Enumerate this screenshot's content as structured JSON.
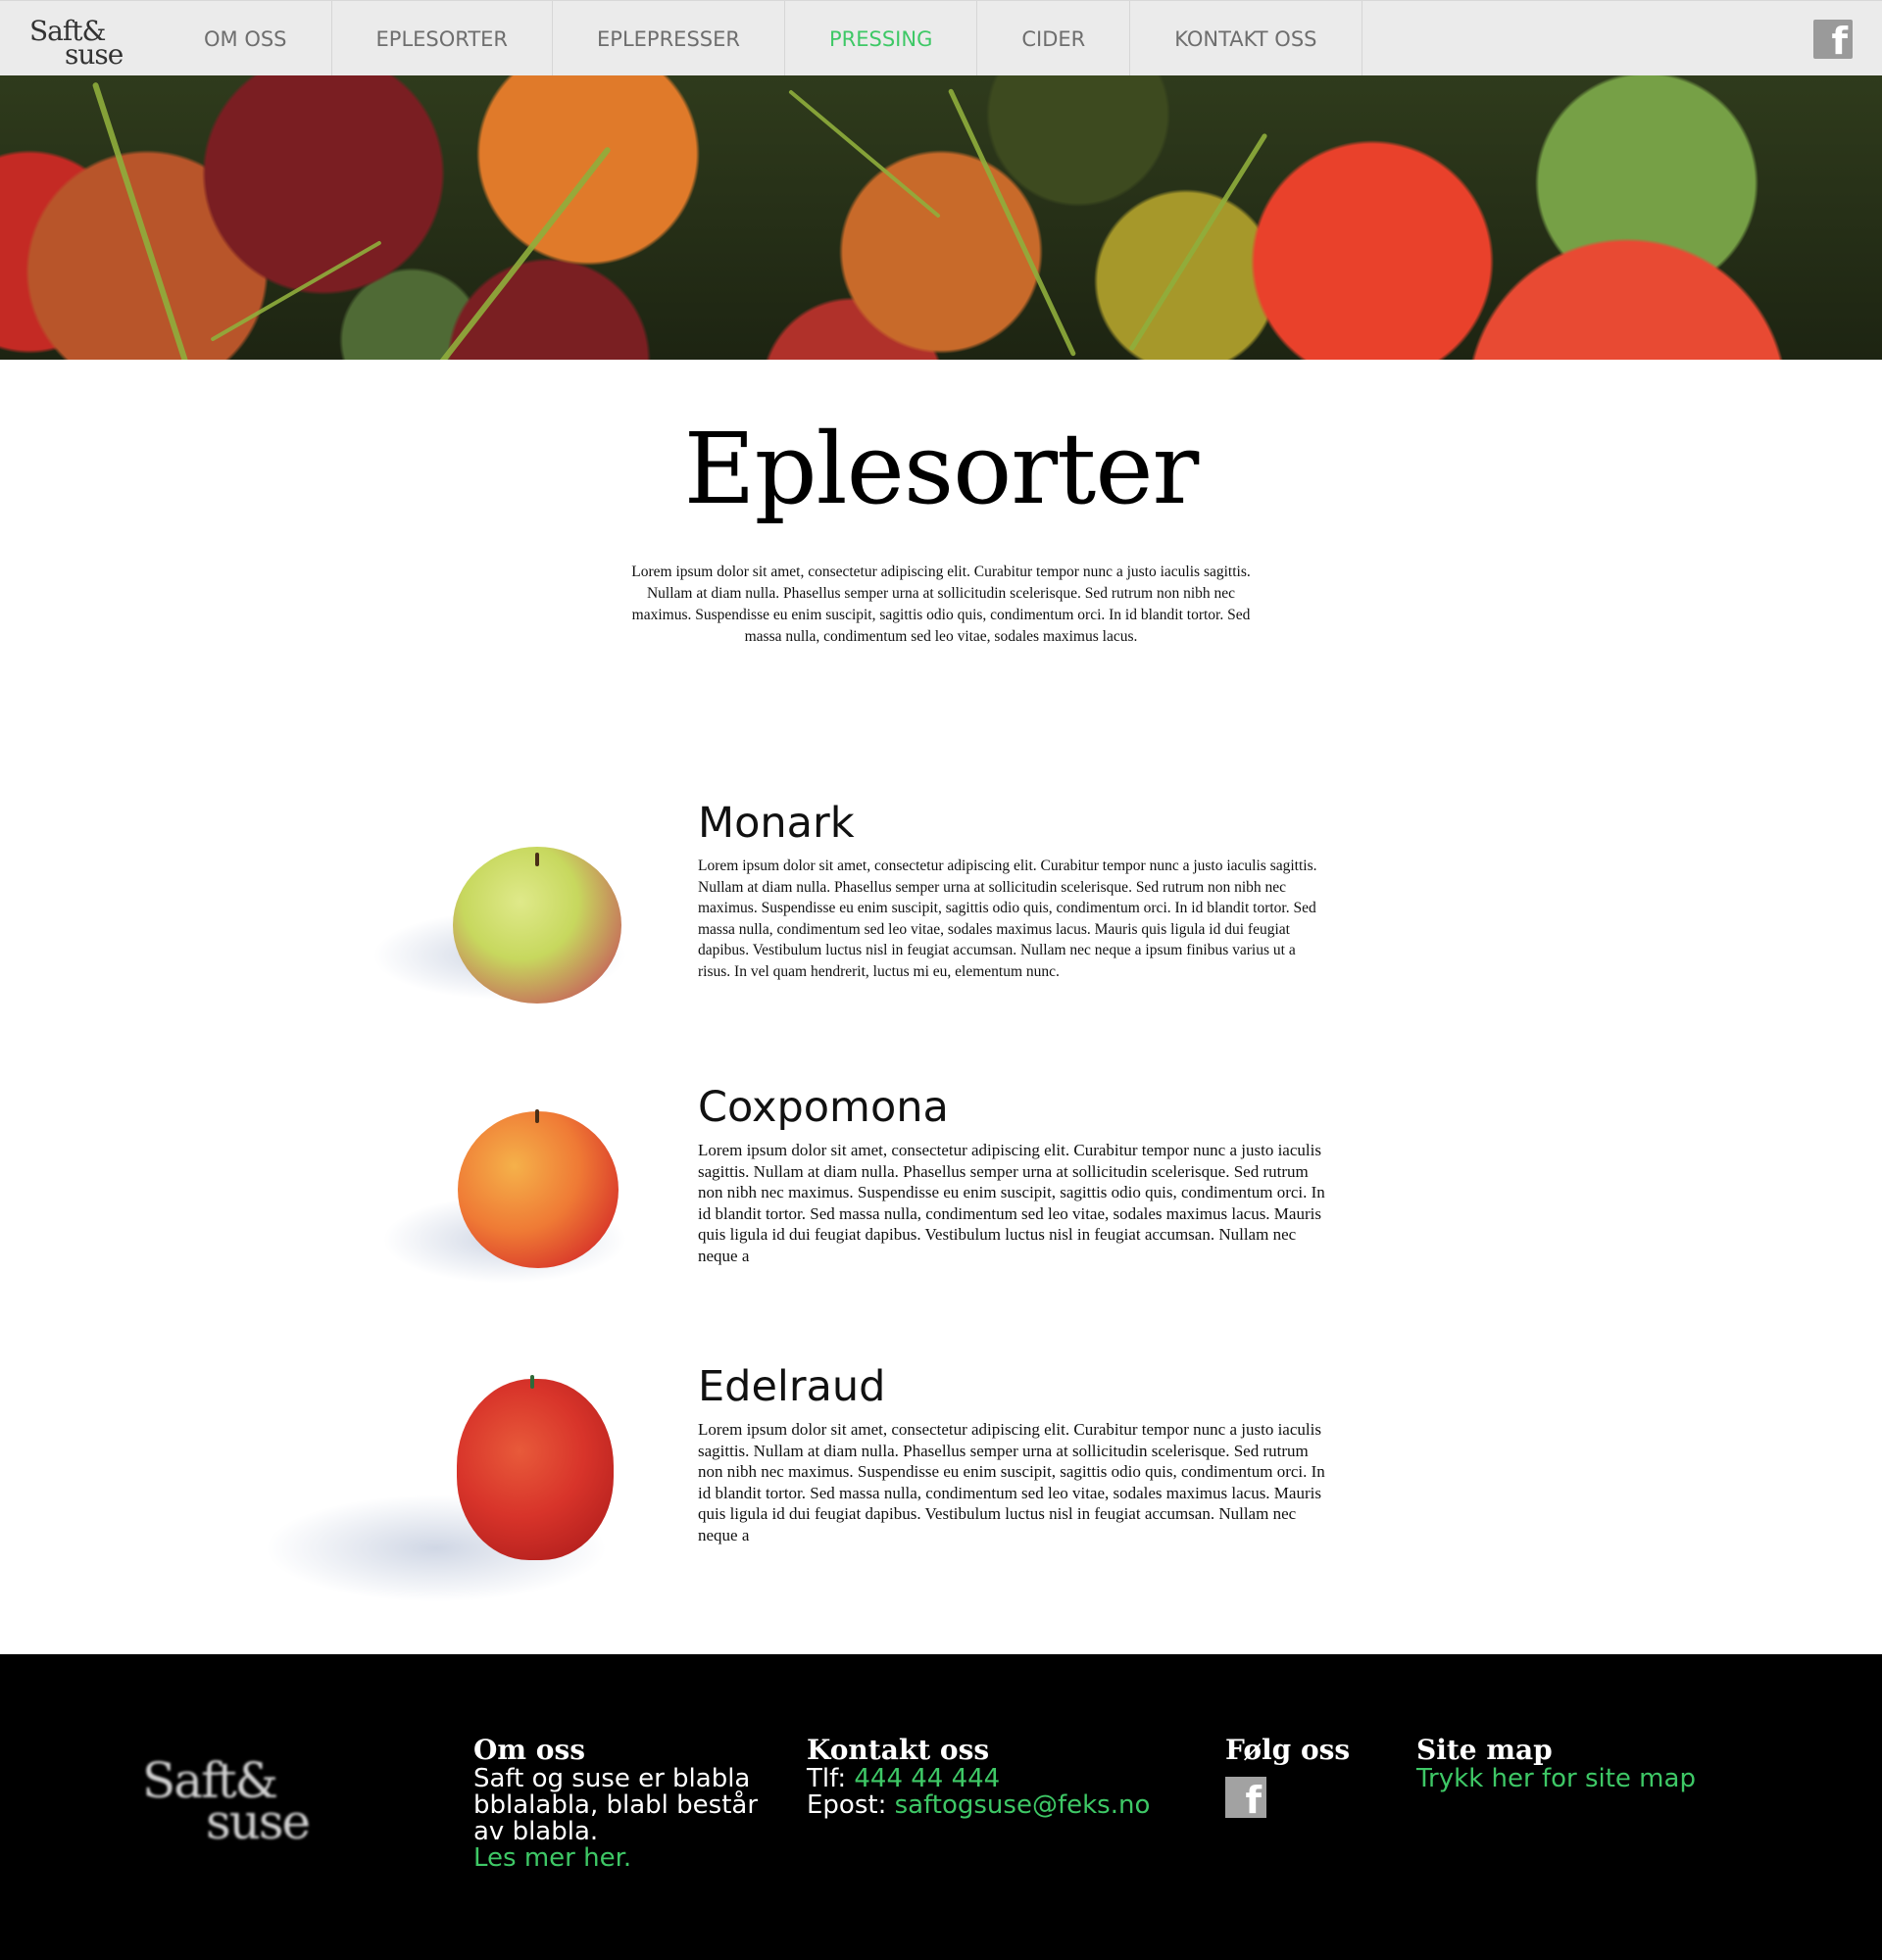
{
  "nav": {
    "logo_line1": "Saft&",
    "logo_line2": "suse",
    "items": [
      {
        "label": "OM OSS"
      },
      {
        "label": "EPLESORTER"
      },
      {
        "label": "EPLEPRESSER"
      },
      {
        "label": "PRESSING"
      },
      {
        "label": "CIDER"
      },
      {
        "label": "KONTAKT OSS"
      }
    ],
    "active_item": "PRESSING",
    "facebook_icon": "facebook-icon"
  },
  "colors": {
    "accent_green": "#3ec866",
    "nav_background": "#ebebeb",
    "footer_background": "#000000"
  },
  "main": {
    "title": "Eplesorter",
    "intro": "Lorem ipsum dolor sit amet, consectetur adipiscing elit. Curabitur tempor nunc a justo iaculis sagittis. Nullam at diam nulla. Phasellus semper urna at sollicitudin scelerisque. Sed rutrum non nibh nec maximus. Suspendisse eu enim suscipit, sagittis odio quis, condimentum orci. In id blandit tortor. Sed massa nulla, condimentum sed leo vitae, sodales maximus lacus."
  },
  "varieties": [
    {
      "name": "Monark",
      "text": "Lorem ipsum dolor sit amet, consectetur adipiscing elit. Curabitur tempor nunc a justo iaculis sagittis. Nullam at diam nulla. Phasellus semper urna at sollicitudin scelerisque. Sed rutrum non nibh nec maximus. Suspendisse eu enim suscipit, sagittis odio quis, condimentum orci. In id blandit tortor. Sed massa nulla, condimentum sed leo vitae, sodales maximus lacus. Mauris quis ligula id dui feugiat dapibus. Vestibulum luctus nisl in feugiat accumsan. Nullam nec neque a ipsum finibus varius ut a risus. In vel quam hendrerit, luctus mi eu, elementum nunc."
    },
    {
      "name": "Coxpomona",
      "text": "Lorem ipsum dolor sit amet, consectetur adipiscing elit. Curabitur tempor nunc a justo iaculis sagittis. Nullam at diam nulla. Phasellus semper urna at sollicitudin scelerisque. Sed rutrum non nibh nec maximus. Suspendisse eu enim suscipit, sagittis odio quis, condimentum orci. In id blandit tortor. Sed massa nulla, condimentum sed leo vitae, sodales maximus lacus. Mauris quis ligula id dui feugiat dapibus. Vestibulum luctus nisl in feugiat accumsan. Nullam nec neque a"
    },
    {
      "name": "Edelraud",
      "text": "Lorem ipsum dolor sit amet, consectetur adipiscing elit. Curabitur tempor nunc a justo iaculis sagittis. Nullam at diam nulla. Phasellus semper urna at sollicitudin scelerisque. Sed rutrum non nibh nec maximus. Suspendisse eu enim suscipit, sagittis odio quis, condimentum orci. In id blandit tortor. Sed massa nulla, condimentum sed leo vitae, sodales maximus lacus. Mauris quis ligula id dui feugiat dapibus. Vestibulum luctus nisl in feugiat accumsan. Nullam nec neque a"
    }
  ],
  "footer": {
    "logo_line1": "Saft&",
    "logo_line2": "suse",
    "about": {
      "heading": "Om oss",
      "line1": "Saft og suse er blabla",
      "line2": "bblalabla, blabl består",
      "line3": "av blabla.",
      "link": "Les mer her."
    },
    "contact": {
      "heading": "Kontakt oss",
      "phone_label": "Tlf: ",
      "phone": "444 44 444",
      "email_label": "Epost: ",
      "email": "saftogsuse@feks.no"
    },
    "follow": {
      "heading": "Følg oss",
      "icon": "facebook-icon"
    },
    "sitemap": {
      "heading": "Site map",
      "link": "Trykk her for site map"
    }
  }
}
